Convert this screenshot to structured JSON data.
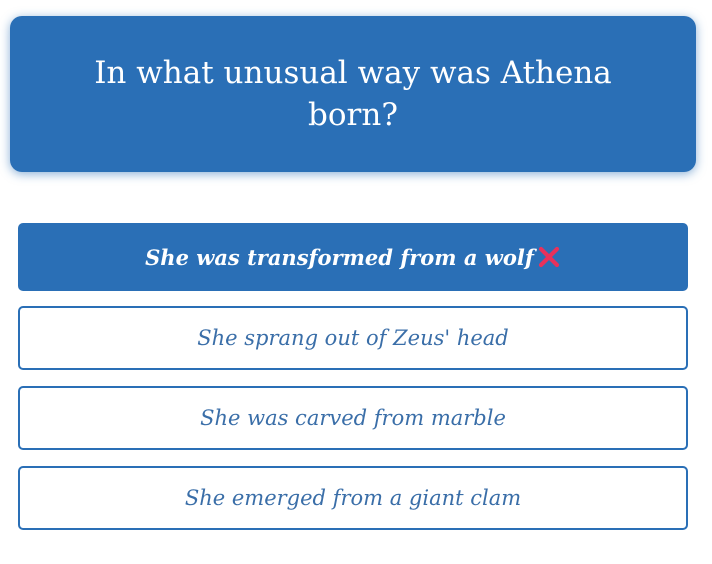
{
  "question": {
    "text": "In what unusual way was Athena born?"
  },
  "answers": [
    {
      "label": "She was transformed from a wolf",
      "state": "selected-wrong",
      "status_icon": "cross-mark-icon"
    },
    {
      "label": "She sprang out of Zeus' head",
      "state": "unselected"
    },
    {
      "label": "She was carved from marble",
      "state": "unselected"
    },
    {
      "label": "She emerged from a giant clam",
      "state": "unselected"
    }
  ],
  "colors": {
    "accent": "#2a6fb6",
    "wrong_mark": "#e8315b",
    "option_text": "#3a6ea8"
  }
}
